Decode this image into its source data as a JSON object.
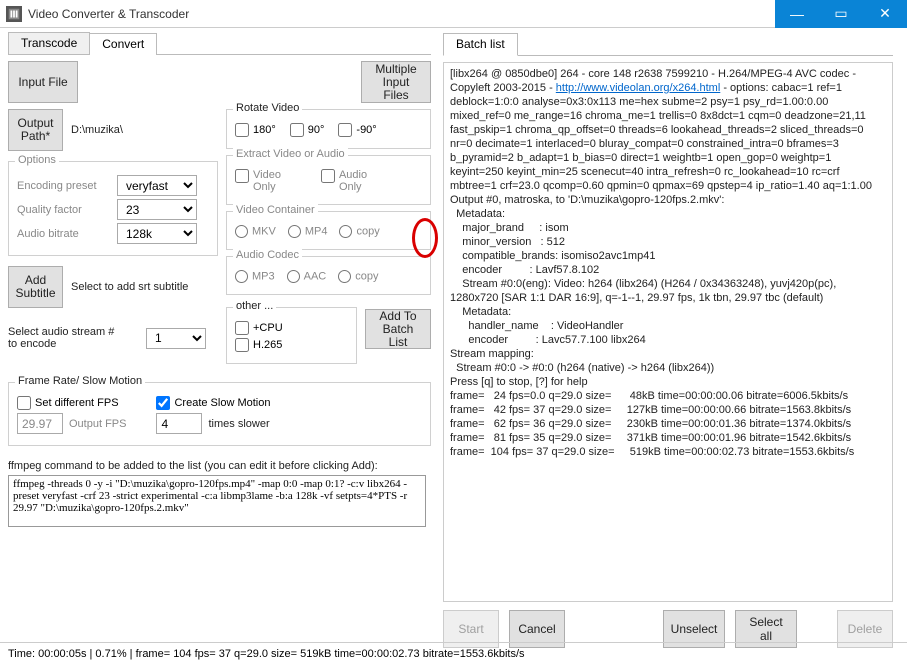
{
  "titlebar": {
    "title": "Video Converter & Transcoder"
  },
  "tabs_left": {
    "transcode": "Transcode",
    "convert": "Convert"
  },
  "tabs_right": {
    "batchlist": "Batch list"
  },
  "buttons": {
    "input_file": "Input File",
    "multi_input": "Multiple\nInput Files",
    "output_path": "Output\nPath*",
    "add_subtitle": "Add\nSubtitle",
    "add_to_batch": "Add To\nBatch List",
    "start": "Start",
    "cancel": "Cancel",
    "unselect": "Unselect",
    "select_all": "Select all",
    "delete": "Delete"
  },
  "paths": {
    "output": "D:\\muzika\\"
  },
  "options": {
    "legend": "Options",
    "encoding_preset_label": "Encoding preset",
    "encoding_preset_value": "veryfast",
    "quality_label": "Quality factor",
    "quality_value": "23",
    "audio_bitrate_label": "Audio bitrate",
    "audio_bitrate_value": "128k"
  },
  "rotate": {
    "legend": "Rotate Video",
    "opt1": "180°",
    "opt2": "90°",
    "opt3": "-90°"
  },
  "extract": {
    "legend": "Extract Video or Audio",
    "video_only": "Video\nOnly",
    "audio_only": "Audio\nOnly"
  },
  "vcontainer": {
    "legend": "Video Container",
    "mkv": "MKV",
    "mp4": "MP4",
    "copy": "copy"
  },
  "acodec": {
    "legend": "Audio Codec",
    "mp3": "MP3",
    "aac": "AAC",
    "copy": "copy"
  },
  "other": {
    "legend": "other ...",
    "cpu": "+CPU",
    "h265": "H.265"
  },
  "subtitle_hint": "Select to add srt subtitle",
  "audio_stream": {
    "label": "Select audio stream #\nto encode",
    "value": "1"
  },
  "fps": {
    "legend": "Frame Rate/ Slow Motion",
    "set_diff": "Set different FPS",
    "fps_value": "29.97",
    "fps_label": "Output FPS",
    "slowmo": "Create Slow Motion",
    "slowmo_value": "4",
    "slowmo_label": "times slower"
  },
  "cmd_label": "ffmpeg command to be added to the list (you can edit it before clicking Add):",
  "cmd_value": "ffmpeg -threads 0 -y -i \"D:\\muzika\\gopro-120fps.mp4\" -map 0:0 -map 0:1? -c:v libx264 -preset veryfast -crf 23 -strict experimental -c:a libmp3lame -b:a 128k -vf setpts=4*PTS -r 29.97 \"D:\\muzika\\gopro-120fps.2.mkv\"",
  "log_pre": "[libx264 @ 0850dbe0] 264 - core 148 r2638 7599210 - H.264/MPEG-4 AVC codec - Copyleft 2003-2015 - ",
  "log_link": "http://www.videolan.org/x264.html",
  "log_post": " - options: cabac=1 ref=1 deblock=1:0:0 analyse=0x3:0x113 me=hex subme=2 psy=1 psy_rd=1.00:0.00 mixed_ref=0 me_range=16 chroma_me=1 trellis=0 8x8dct=1 cqm=0 deadzone=21,11 fast_pskip=1 chroma_qp_offset=0 threads=6 lookahead_threads=2 sliced_threads=0 nr=0 decimate=1 interlaced=0 bluray_compat=0 constrained_intra=0 bframes=3 b_pyramid=2 b_adapt=1 b_bias=0 direct=1 weightb=1 open_gop=0 weightp=1 keyint=250 keyint_min=25 scenecut=40 intra_refresh=0 rc_lookahead=10 rc=crf mbtree=1 crf=23.0 qcomp=0.60 qpmin=0 qpmax=69 qpstep=4 ip_ratio=1.40 aq=1:1.00\nOutput #0, matroska, to 'D:\\muzika\\gopro-120fps.2.mkv':\n  Metadata:\n    major_brand     : isom\n    minor_version   : 512\n    compatible_brands: isomiso2avc1mp41\n    encoder         : Lavf57.8.102\n    Stream #0:0(eng): Video: h264 (libx264) (H264 / 0x34363248), yuvj420p(pc), 1280x720 [SAR 1:1 DAR 16:9], q=-1--1, 29.97 fps, 1k tbn, 29.97 tbc (default)\n    Metadata:\n      handler_name    : VideoHandler\n      encoder         : Lavc57.7.100 libx264\nStream mapping:\n  Stream #0:0 -> #0:0 (h264 (native) -> h264 (libx264))\nPress [q] to stop, [?] for help\nframe=   24 fps=0.0 q=29.0 size=      48kB time=00:00:00.06 bitrate=6006.5kbits/s\nframe=   42 fps= 37 q=29.0 size=     127kB time=00:00:00.66 bitrate=1563.8kbits/s\nframe=   62 fps= 36 q=29.0 size=     230kB time=00:00:01.36 bitrate=1374.0kbits/s\nframe=   81 fps= 35 q=29.0 size=     371kB time=00:00:01.96 bitrate=1542.6kbits/s\nframe=  104 fps= 37 q=29.0 size=     519kB time=00:00:02.73 bitrate=1553.6kbits/s",
  "status": "Time: 00:00:05s |  0.71% |   frame=  104 fps= 37 q=29.0 size=     519kB time=00:00:02.73 bitrate=1553.6kbits/s"
}
